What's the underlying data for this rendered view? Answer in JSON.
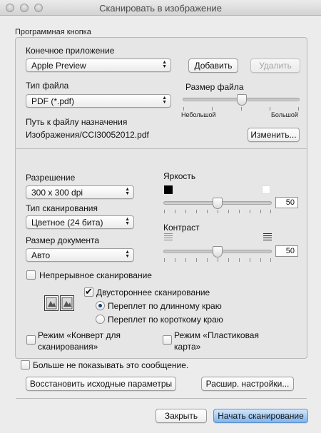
{
  "window": {
    "title": "Сканировать в изображение"
  },
  "group": {
    "label": "Программная кнопка"
  },
  "target_app": {
    "label": "Конечное приложение",
    "selected": "Apple Preview",
    "add_label": "Добавить",
    "delete_label": "Удалить"
  },
  "file_type": {
    "label": "Тип файла",
    "selected": "PDF (*.pdf)"
  },
  "file_size": {
    "label": "Размер файла",
    "min_label": "Небольшой",
    "max_label": "Большой",
    "level": 0.5
  },
  "dest_path": {
    "label": "Путь к файлу назначения",
    "value": "Изображения/CCI30052012.pdf",
    "change_label": "Изменить..."
  },
  "resolution": {
    "label": "Разрешение",
    "selected": "300 x 300  dpi"
  },
  "scan_type": {
    "label": "Тип сканирования",
    "selected": "Цветное (24 бита)"
  },
  "doc_size": {
    "label": "Размер документа",
    "selected": "Авто"
  },
  "brightness": {
    "label": "Яркость",
    "value": "50",
    "level": 0.5
  },
  "contrast": {
    "label": "Контраст",
    "value": "50",
    "level": 0.5
  },
  "continuous": {
    "label": "Непрерывное сканирование",
    "checked": false
  },
  "duplex": {
    "label": "Двустороннее сканирование",
    "checked": true,
    "long_edge": "Переплет по длинному краю",
    "short_edge": "Переплет по короткому краю",
    "selected": "long"
  },
  "envelope": {
    "line1": "Режим «Конверт для",
    "line2": "сканирования»",
    "checked": false
  },
  "plastic": {
    "line1": "Режим «Пластиковая",
    "line2": "карта»",
    "checked": false
  },
  "dont_show": {
    "label": "Больше не показывать это сообщение.",
    "checked": false
  },
  "restore_label": "Восстановить исходные параметры",
  "advanced_label": "Расшир. настройки...",
  "close_label": "Закрыть",
  "start_label": "Начать сканирование"
}
